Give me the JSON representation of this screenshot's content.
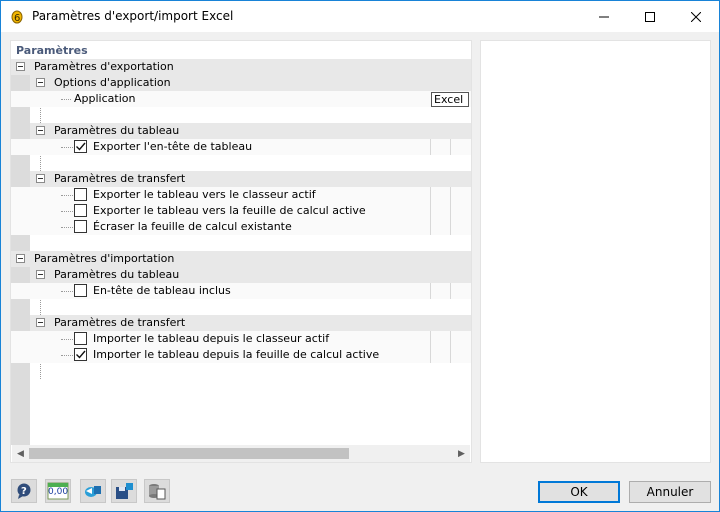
{
  "window": {
    "title": "Paramètres d'export/import Excel",
    "accent_color": "#1883d7"
  },
  "panel": {
    "header": "Paramètres"
  },
  "tree": {
    "export_group": "Paramètres d'exportation",
    "app_options": "Options d'application",
    "application_label": "Application",
    "application_value": "Excel",
    "table_params_1": "Paramètres du tableau",
    "export_header": "Exporter l'en-tête de tableau",
    "transfer_params_1": "Paramètres de transfert",
    "export_to_workbook": "Exporter le tableau vers le classeur actif",
    "export_to_sheet": "Exporter le tableau vers la feuille de calcul active",
    "overwrite_sheet": "Écraser la feuille de calcul existante",
    "import_group": "Paramètres d'importation",
    "table_params_2": "Paramètres du tableau",
    "header_included": "En-tête de tableau inclus",
    "transfer_params_2": "Paramètres de transfert",
    "import_from_workbook": "Importer le tableau depuis le classeur actif",
    "import_from_sheet": "Importer le tableau depuis la feuille de calcul active"
  },
  "checks": {
    "export_header": true,
    "export_to_workbook": false,
    "export_to_sheet": false,
    "overwrite_sheet": false,
    "header_included": false,
    "import_from_workbook": false,
    "import_from_sheet": true
  },
  "toolbar": {
    "icons": [
      "help-icon",
      "decimal-places-icon",
      "export-icon",
      "save-settings-icon",
      "load-settings-icon"
    ],
    "decimal_label": "0,00"
  },
  "buttons": {
    "ok": "OK",
    "cancel": "Annuler"
  }
}
